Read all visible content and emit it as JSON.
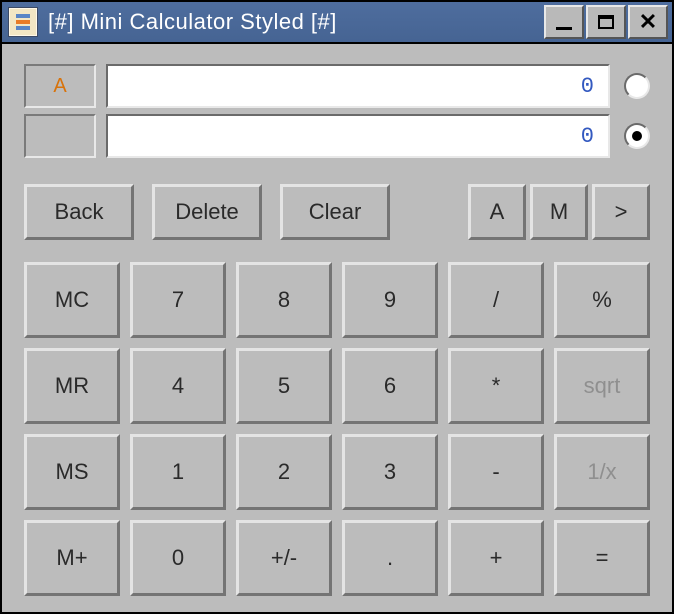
{
  "window": {
    "title": "[#] Mini Calculator Styled [#]"
  },
  "display": {
    "row_a": {
      "label": "A",
      "value": "0",
      "selected": false
    },
    "row_b": {
      "label": "",
      "value": "0",
      "selected": true
    }
  },
  "edit": {
    "back": "Back",
    "delete": "Delete",
    "clear": "Clear",
    "a": "A",
    "m": "M",
    "more": ">"
  },
  "keys": {
    "mc": "MC",
    "n7": "7",
    "n8": "8",
    "n9": "9",
    "div": "/",
    "pct": "%",
    "mr": "MR",
    "n4": "4",
    "n5": "5",
    "n6": "6",
    "mul": "*",
    "sqrt": "sqrt",
    "ms": "MS",
    "n1": "1",
    "n2": "2",
    "n3": "3",
    "sub": "-",
    "inv": "1/x",
    "mp": "M+",
    "n0": "0",
    "pm": "+/-",
    "dot": ".",
    "add": "+",
    "eq": "="
  }
}
